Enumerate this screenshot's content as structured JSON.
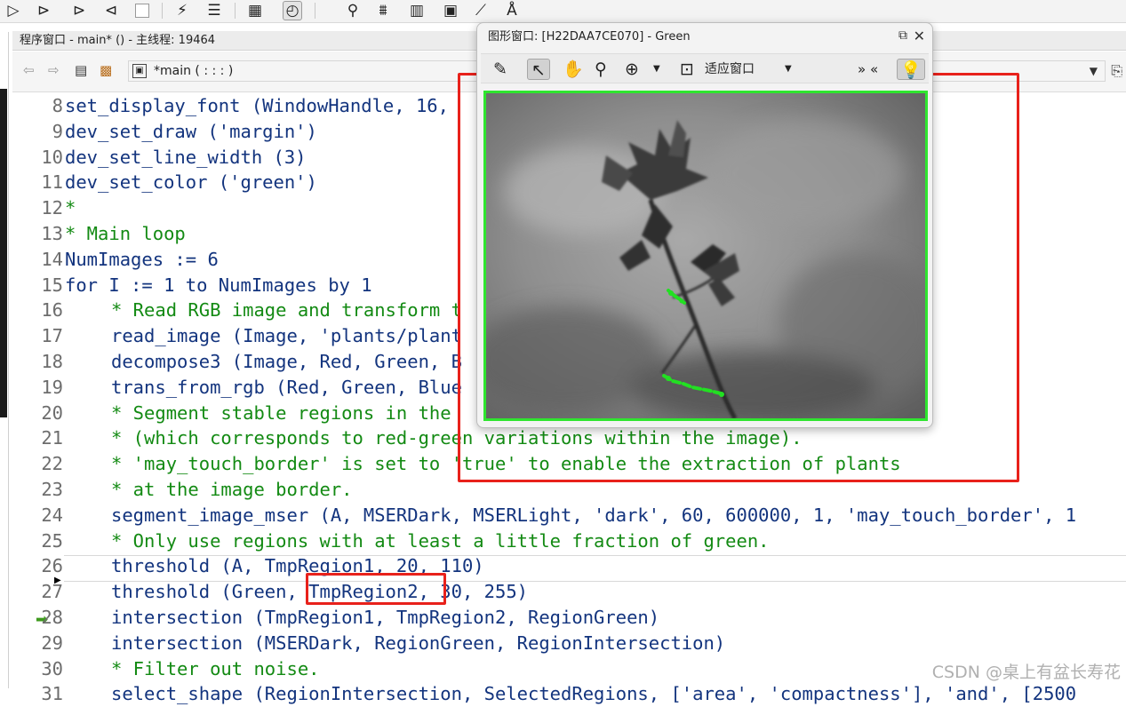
{
  "program_window": {
    "title": "程序窗口 - main* () - 主线程: 19464",
    "procedure_combo": "*main ( : : : )"
  },
  "graphics_window": {
    "title": "图形窗口: [H22DAA7CE070] - Green",
    "fit_window_label": "适应窗口",
    "chevrons": "» «"
  },
  "code_lines": [
    {
      "num": "8",
      "text": "set_display_font (WindowHandle, 16,",
      "type": "op",
      "indent": false
    },
    {
      "num": "9",
      "text": "dev_set_draw ('margin')",
      "type": "op",
      "indent": false
    },
    {
      "num": "10",
      "text": "dev_set_line_width (3)",
      "type": "op",
      "indent": false
    },
    {
      "num": "11",
      "text": "dev_set_color ('green')",
      "type": "op",
      "indent": false
    },
    {
      "num": "12",
      "text": "*",
      "type": "cmt",
      "indent": false
    },
    {
      "num": "13",
      "text": "* Main loop",
      "type": "cmt",
      "indent": false
    },
    {
      "num": "14",
      "text": "NumImages := 6",
      "type": "op",
      "indent": false
    },
    {
      "num": "15",
      "text": "for I := 1 to NumImages by 1",
      "type": "op",
      "indent": false
    },
    {
      "num": "16",
      "text": "* Read RGB image and transform t",
      "type": "cmt",
      "indent": true
    },
    {
      "num": "17",
      "text": "read_image (Image, 'plants/plant",
      "type": "op",
      "indent": true
    },
    {
      "num": "18",
      "text": "decompose3 (Image, Red, Green, B",
      "type": "op",
      "indent": true
    },
    {
      "num": "19",
      "text": "trans_from_rgb (Red, Green, Blue",
      "type": "op",
      "indent": true
    },
    {
      "num": "20",
      "text": "* Segment stable regions in the",
      "type": "cmt",
      "indent": true
    },
    {
      "num": "21",
      "text": "* (which corresponds to red-green variations within the image).",
      "type": "cmt",
      "indent": true
    },
    {
      "num": "22",
      "text": "* 'may_touch_border' is set to 'true' to enable the extraction of plants",
      "type": "cmt",
      "indent": true
    },
    {
      "num": "23",
      "text": "* at the image border.",
      "type": "cmt",
      "indent": true
    },
    {
      "num": "24",
      "text": "segment_image_mser (A, MSERDark, MSERLight, 'dark', 60, 600000, 1, 'may_touch_border', 1",
      "type": "op",
      "indent": true
    },
    {
      "num": "25",
      "text": "* Only use regions with at least a little fraction of green.",
      "type": "cmt",
      "indent": true
    },
    {
      "num": "26",
      "text": "threshold (A, TmpRegion1, 20, 110)",
      "type": "op",
      "indent": true
    },
    {
      "num": "27",
      "text": "threshold (Green, TmpRegion2, 30, 255)",
      "type": "op",
      "indent": true
    },
    {
      "num": "28",
      "text": "intersection (TmpRegion1, TmpRegion2, RegionGreen)",
      "type": "op",
      "indent": true
    },
    {
      "num": "29",
      "text": "intersection (MSERDark, RegionGreen, RegionIntersection)",
      "type": "op",
      "indent": true
    },
    {
      "num": "30",
      "text": "* Filter out noise.",
      "type": "cmt",
      "indent": true
    },
    {
      "num": "31",
      "text": "select_shape (RegionIntersection, SelectedRegions, ['area', 'compactness'], 'and', [2500",
      "type": "op",
      "indent": true
    }
  ],
  "watermark": "CSDN @桌上有盆长寿花",
  "colors": {
    "operator_text": "#13347e",
    "comment_text": "#138a13",
    "highlight_box": "#e8211b",
    "graphics_border": "#2fe52f",
    "region_color": "#22e022"
  },
  "icons": {
    "toolbar": [
      "run-icon",
      "step-icon",
      "step-over-icon",
      "step-back-icon",
      "stop-icon",
      "execute-icon",
      "document-icon",
      "image-icon",
      "gauge-icon",
      "search-icon",
      "chart-icon",
      "histogram-icon",
      "image-view-icon",
      "line-chart-icon",
      "font-icon"
    ],
    "graphics_toolbar": [
      "brush-icon",
      "pointer-icon",
      "hand-icon",
      "zoom-icon",
      "zoom-in-icon",
      "fit-window-icon",
      "bulb-icon"
    ]
  }
}
